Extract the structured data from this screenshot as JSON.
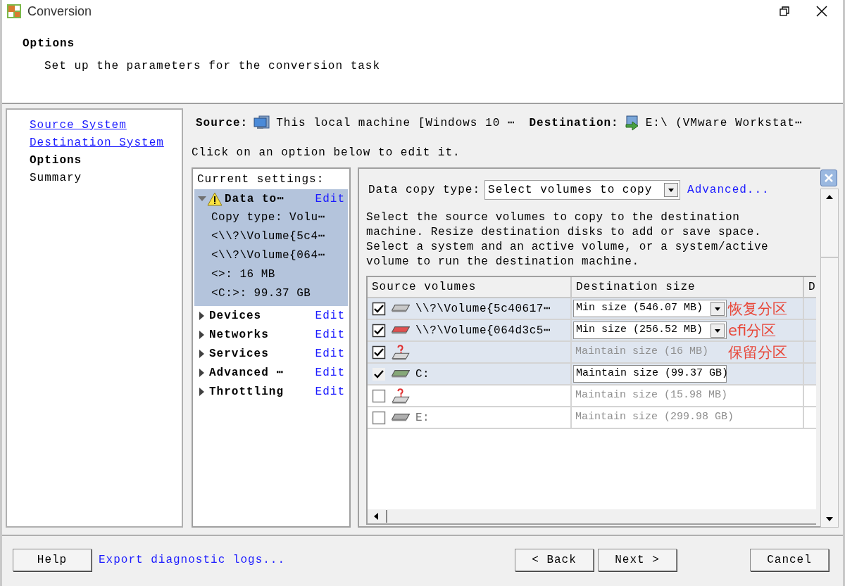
{
  "window": {
    "title": "Conversion"
  },
  "header": {
    "title": "Options",
    "subtitle": "Set up the parameters for the conversion task"
  },
  "steps": [
    {
      "label": "Source System",
      "kind": "done"
    },
    {
      "label": "Destination System",
      "kind": "done"
    },
    {
      "label": "Options",
      "kind": "current"
    },
    {
      "label": "Summary",
      "kind": "todo"
    }
  ],
  "summary_line": {
    "source_label": "Source:",
    "source": "This local machine [Windows 10 ⋯",
    "destination_label": "Destination:",
    "destination": "E:\\ (VMware Workstat⋯"
  },
  "instruction": "Click on an option below to edit it.",
  "settings": {
    "title": "Current settings:",
    "items": [
      {
        "label": "Data to⋯",
        "warning": true,
        "expanded": true,
        "selected": true,
        "edit": "Edit",
        "children": [
          "Copy type: Volu⋯",
          "<\\\\?\\Volume{5c4⋯",
          "<\\\\?\\Volume{064⋯",
          "<>: 16 MB",
          "<C:>: 99.37 GB"
        ]
      },
      {
        "label": "Devices",
        "warning": false,
        "expanded": false,
        "selected": false,
        "edit": "Edit"
      },
      {
        "label": "Networks",
        "warning": false,
        "expanded": false,
        "selected": false,
        "edit": "Edit"
      },
      {
        "label": "Services",
        "warning": false,
        "expanded": false,
        "selected": false,
        "edit": "Edit"
      },
      {
        "label": "Advanced ⋯",
        "warning": false,
        "expanded": false,
        "selected": false,
        "edit": "Edit"
      },
      {
        "label": "Throttling",
        "warning": false,
        "expanded": false,
        "selected": false,
        "edit": "Edit"
      }
    ]
  },
  "data_copy": {
    "label": "Data copy type:",
    "value": "Select volumes to copy",
    "advanced": "Advanced...",
    "description": "Select the source volumes to copy to the destination machine. Resize destination disks to add or save space. Select a system and an active volume, or a system/active volume to run the destination machine."
  },
  "table": {
    "columns": [
      "Source volumes",
      "Destination size",
      "D"
    ],
    "rows": [
      {
        "checked": true,
        "locked": false,
        "kind": "disk",
        "color": "#c8c8c8",
        "source": "\\\\?\\Volume{5c40617⋯",
        "destination": {
          "kind": "dropdown",
          "text": "Min size (546.07 MB)"
        }
      },
      {
        "checked": true,
        "locked": false,
        "kind": "disk",
        "color": "#e05050",
        "source": "\\\\?\\Volume{064d3c5⋯",
        "destination": {
          "kind": "dropdown",
          "text": "Min size (256.52 MB)"
        }
      },
      {
        "checked": true,
        "locked": false,
        "kind": "unknown",
        "destination": {
          "kind": "text",
          "text": "Maintain size (16 MB)"
        }
      },
      {
        "checked": true,
        "locked": true,
        "kind": "disk",
        "color": "#86a878",
        "source": "C:",
        "destination": {
          "kind": "dropdown",
          "text": "Maintain size (99.37 GB)"
        }
      },
      {
        "checked": false,
        "locked": false,
        "kind": "unknown",
        "destination": {
          "kind": "text",
          "text": "Maintain size (15.98 MB)"
        }
      },
      {
        "checked": false,
        "locked": false,
        "kind": "disk",
        "color": "#b0b0b0",
        "source": "E:",
        "destination": {
          "kind": "text",
          "text": "Maintain size (299.98 GB)"
        }
      }
    ]
  },
  "annotations": [
    "恢复分区",
    "efi分区",
    "保留分区"
  ],
  "buttons": {
    "help": "Help",
    "export": "Export diagnostic logs...",
    "back": "< Back",
    "next": "Next >",
    "cancel": "Cancel"
  }
}
